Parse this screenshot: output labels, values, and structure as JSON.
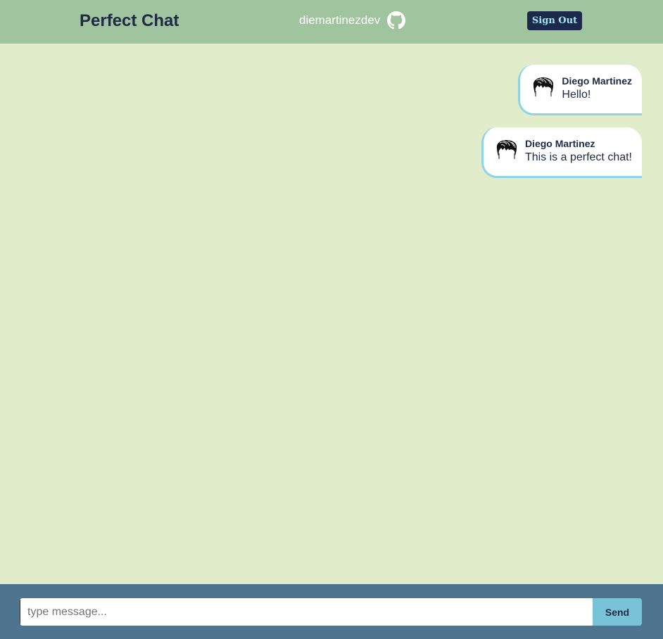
{
  "header": {
    "title": "Perfect Chat",
    "username": "diemartinezdev",
    "github_icon": "github-icon",
    "signout_label": "Sign Out"
  },
  "messages": [
    {
      "author": "Diego Martinez",
      "text": "Hello!",
      "avatar_icon": "hair-avatar-icon"
    },
    {
      "author": "Diego Martinez",
      "text": "This is a perfect chat!",
      "avatar_icon": "hair-avatar-icon"
    }
  ],
  "composer": {
    "placeholder": "type message...",
    "value": "",
    "send_label": "Send"
  },
  "colors": {
    "header_bg": "#a0c49e",
    "chat_bg": "#e1ecca",
    "footer_bg": "#4e748f",
    "title_text": "#1e2a44",
    "signout_bg": "#1b2a4a",
    "signout_text": "#a9e2f4",
    "bubble_border": "#8fd3e6",
    "send_bg": "#79c3d9"
  }
}
